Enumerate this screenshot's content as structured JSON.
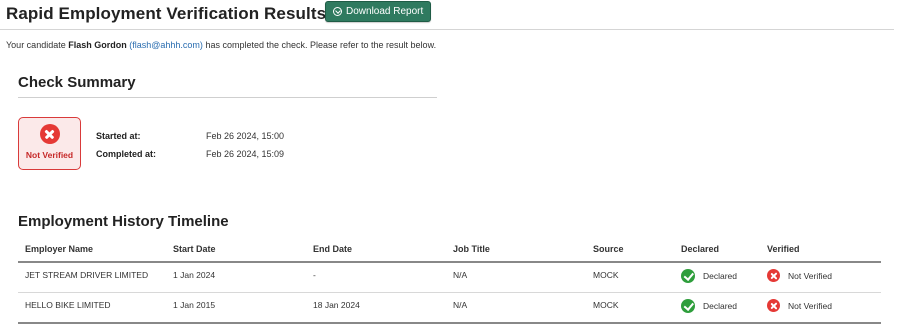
{
  "page": {
    "title": "Rapid Employment Verification Results",
    "download_label": "Download Report"
  },
  "intro": {
    "prefix": "Your candidate",
    "candidate_name": "Flash Gordon",
    "candidate_email": "(flash@ahhh.com)",
    "suffix": "has completed the check. Please refer to the result below."
  },
  "summary": {
    "title": "Check Summary",
    "status": "Not Verified",
    "status_icon": "x-circle-icon",
    "status_color": "#e53935",
    "started_label": "Started at:",
    "started_value": "Feb 26 2024, 15:00",
    "completed_label": "Completed at:",
    "completed_value": "Feb 26 2024, 15:09"
  },
  "timeline": {
    "title": "Employment History Timeline",
    "columns": [
      "Employer Name",
      "Start Date",
      "End Date",
      "Job Title",
      "Source",
      "Declared",
      "Verified"
    ],
    "rows": [
      {
        "employer": "JET STREAM DRIVER LIMITED",
        "start": "1 Jan 2024",
        "end": "-",
        "job_title": "N/A",
        "source": "MOCK",
        "declared": "Declared",
        "declared_icon": "check-circle-icon",
        "verified": "Not Verified",
        "verified_icon": "x-circle-icon"
      },
      {
        "employer": "HELLO BIKE LIMITED",
        "start": "1 Jan 2015",
        "end": "18 Jan 2024",
        "job_title": "N/A",
        "source": "MOCK",
        "declared": "Declared",
        "declared_icon": "check-circle-icon",
        "verified": "Not Verified",
        "verified_icon": "x-circle-icon"
      }
    ]
  },
  "colors": {
    "accent_button": "#2f7a5f",
    "declared_green": "#2e9e3c",
    "not_verified_red": "#e53935",
    "link_blue": "#2a6db0"
  }
}
